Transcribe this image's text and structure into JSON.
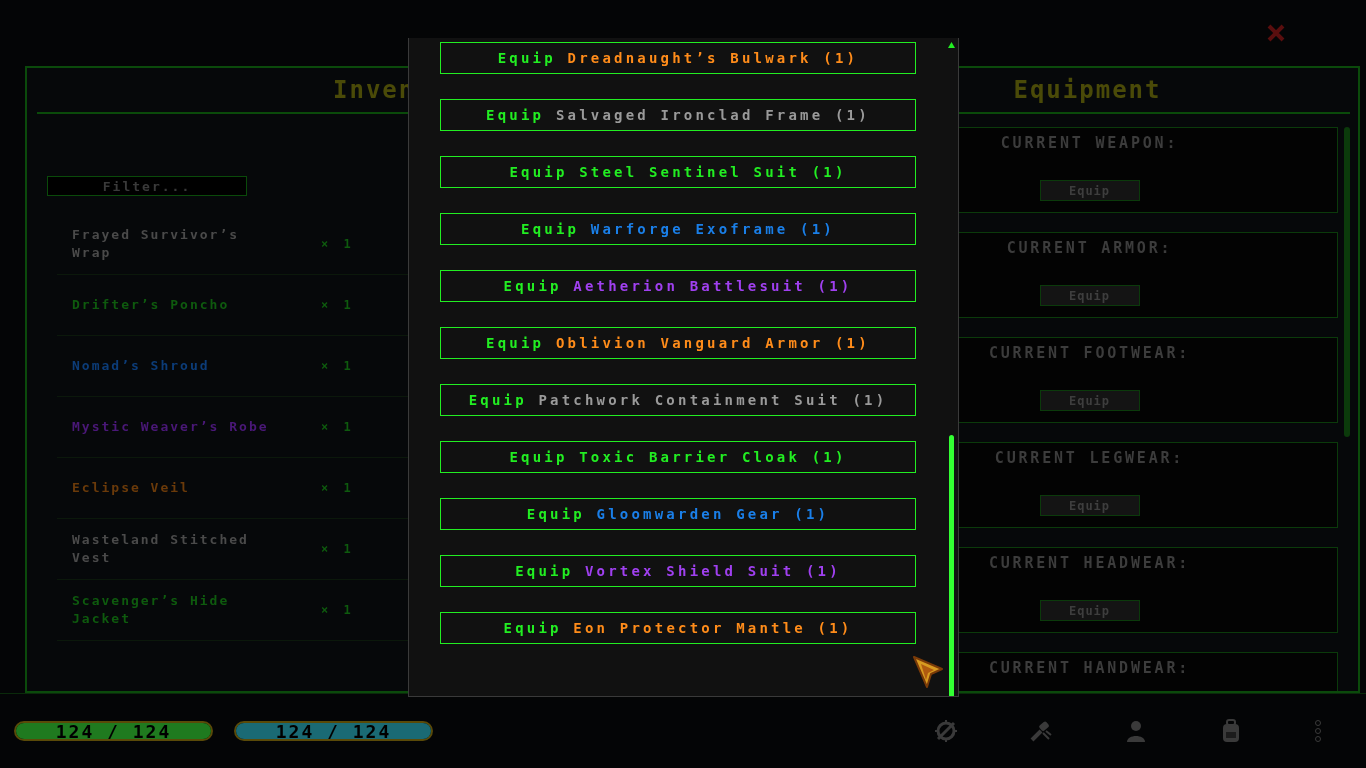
{
  "inventory": {
    "title": "Inven",
    "filter": {
      "placeholder": "Filter..."
    },
    "items": [
      {
        "name": "Frayed Survivor’s Wrap",
        "count": "× 1",
        "color": "#4a4a4a"
      },
      {
        "name": "Drifter’s Poncho",
        "count": "× 1",
        "color": "#0e5a0e"
      },
      {
        "name": "Nomad’s Shroud",
        "count": "× 1",
        "color": "#0c3c78"
      },
      {
        "name": "Mystic Weaver’s Robe",
        "count": "× 1",
        "color": "#4a1878"
      },
      {
        "name": "Eclipse Veil",
        "count": "× 1",
        "color": "#6a3a0a"
      },
      {
        "name": "Wasteland Stitched Vest",
        "count": "× 1",
        "color": "#4a4a4a"
      },
      {
        "name": "Scavenger’s Hide Jacket",
        "count": "× 1",
        "color": "#0e5a0e"
      }
    ]
  },
  "equipment": {
    "title": "Equipment",
    "slots": [
      {
        "label": "CURRENT WEAPON:",
        "button": "Equip"
      },
      {
        "label": "CURRENT ARMOR:",
        "button": "Equip"
      },
      {
        "label": "CURRENT FOOTWEAR:",
        "button": "Equip"
      },
      {
        "label": "CURRENT LEGWEAR:",
        "button": "Equip"
      },
      {
        "label": "CURRENT HEADWEAR:",
        "button": "Equip"
      },
      {
        "label": "CURRENT HANDWEAR:"
      }
    ]
  },
  "modal": {
    "items": [
      {
        "action": "Equip",
        "name": "Dreadnaught’s Bulwark",
        "count": "(1)",
        "color": "#ff8c1a"
      },
      {
        "action": "Equip",
        "name": "Salvaged Ironclad Frame",
        "count": "(1)",
        "color": "#9a9a9a"
      },
      {
        "action": "Equip",
        "name": "Steel Sentinel Suit",
        "count": "(1)",
        "color": "#22ee22"
      },
      {
        "action": "Equip",
        "name": "Warforge Exoframe",
        "count": "(1)",
        "color": "#1a7fe8"
      },
      {
        "action": "Equip",
        "name": "Aetherion Battlesuit",
        "count": "(1)",
        "color": "#a040f0"
      },
      {
        "action": "Equip",
        "name": "Oblivion Vanguard Armor",
        "count": "(1)",
        "color": "#ff8c1a"
      },
      {
        "action": "Equip",
        "name": "Patchwork Containment Suit",
        "count": "(1)",
        "color": "#9a9a9a"
      },
      {
        "action": "Equip",
        "name": "Toxic Barrier Cloak",
        "count": "(1)",
        "color": "#22ee22"
      },
      {
        "action": "Equip",
        "name": "Gloomwarden Gear",
        "count": "(1)",
        "color": "#1a7fe8"
      },
      {
        "action": "Equip",
        "name": "Vortex Shield Suit",
        "count": "(1)",
        "color": "#a040f0"
      },
      {
        "action": "Equip",
        "name": "Eon Protector Mantle",
        "count": "(1)",
        "color": "#ff8c1a"
      }
    ]
  },
  "status": {
    "bars": [
      {
        "text": "124 / 124",
        "level": 1,
        "color": "#1f7a1f"
      },
      {
        "text": "124 / 124",
        "level": 1,
        "color": "#1a6a74"
      }
    ]
  }
}
